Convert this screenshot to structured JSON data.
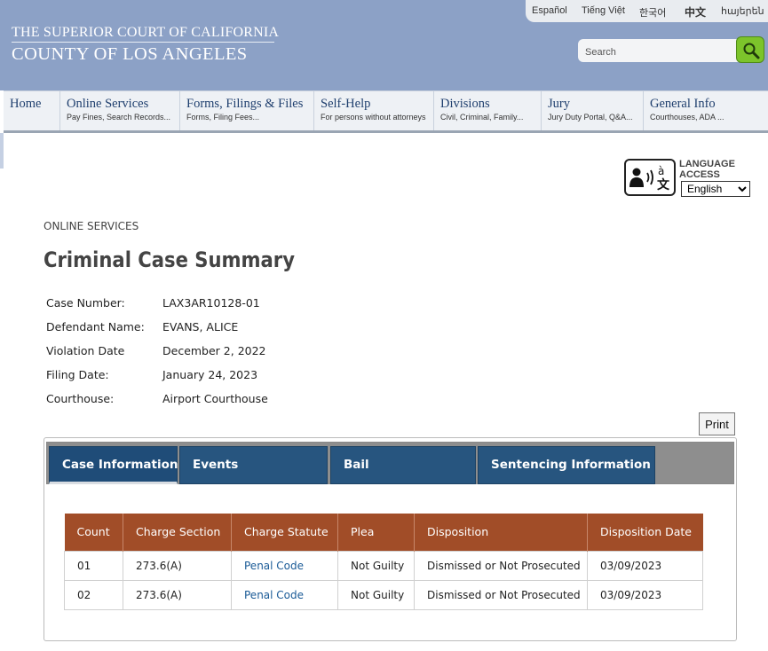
{
  "header": {
    "court_line1": "THE SUPERIOR COURT OF CALIFORNIA",
    "court_line2": "COUNTY OF LOS ANGELES",
    "languages": [
      "Español",
      "Tiếng Việt",
      "한국어",
      "中文",
      "հայերեն"
    ],
    "search_placeholder": "Search",
    "colors": {
      "header_bg": "#8ca1c6",
      "search_button": "#7cc42b"
    }
  },
  "nav": [
    {
      "title": "Home",
      "sub": ""
    },
    {
      "title": "Online Services",
      "sub": "Pay Fines, Search Records..."
    },
    {
      "title": "Forms, Filings & Files",
      "sub": "Forms, Filing Fees..."
    },
    {
      "title": "Self-Help",
      "sub": "For persons without attorneys"
    },
    {
      "title": "Divisions",
      "sub": "Civil, Criminal, Family..."
    },
    {
      "title": "Jury",
      "sub": "Jury Duty Portal, Q&A..."
    },
    {
      "title": "General Info",
      "sub": "Courthouses, ADA ..."
    }
  ],
  "language_access": {
    "label_line1": "LANGUAGE",
    "label_line2": "ACCESS",
    "selected": "English",
    "icon": "language-access-icon"
  },
  "page": {
    "section": "ONLINE SERVICES",
    "title": "Criminal Case Summary",
    "print_label": "Print"
  },
  "summary": [
    {
      "key": "Case Number:",
      "value": "LAX3AR10128-01"
    },
    {
      "key": "Defendant Name:",
      "value": "EVANS, ALICE"
    },
    {
      "key": "Violation Date",
      "value": "December 2, 2022"
    },
    {
      "key": "Filing Date:",
      "value": "January 24, 2023"
    },
    {
      "key": "Courthouse:",
      "value": "Airport Courthouse"
    }
  ],
  "tabs": [
    {
      "label": "Case Information",
      "active": true
    },
    {
      "label": "Events",
      "active": false
    },
    {
      "label": "Bail",
      "active": false
    },
    {
      "label": "Sentencing Information",
      "active": false
    }
  ],
  "charges": {
    "headers": [
      "Count",
      "Charge Section",
      "Charge Statute",
      "Plea",
      "Disposition",
      "Disposition Date"
    ],
    "rows": [
      [
        "01",
        "273.6(A)",
        "Penal Code",
        "Not Guilty",
        "Dismissed or Not Prosecuted",
        "03/09/2023"
      ],
      [
        "02",
        "273.6(A)",
        "Penal Code",
        "Not Guilty",
        "Dismissed or Not Prosecuted",
        "03/09/2023"
      ]
    ],
    "header_color": "#a14d28",
    "link_color": "#1a5a96"
  }
}
